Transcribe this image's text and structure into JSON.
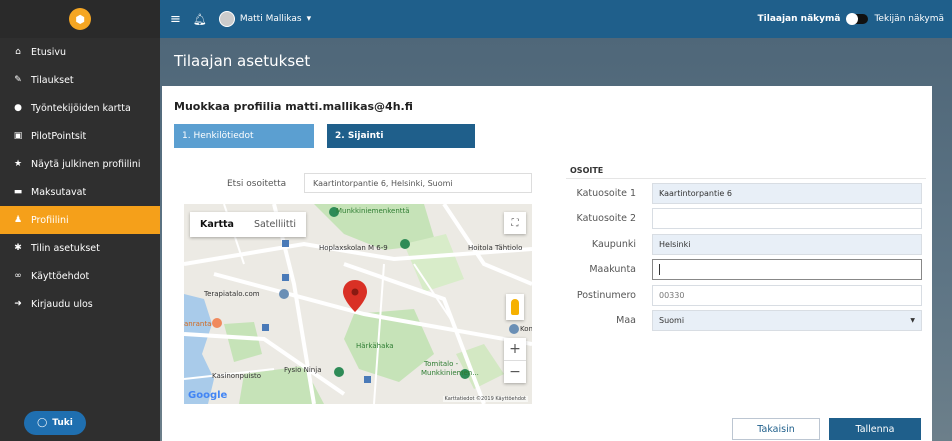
{
  "topbar": {
    "menu_icon": "hamburger-icon",
    "bell_icon": "bell-icon",
    "user_name": "Matti Mallikas",
    "caret": "▾",
    "view_client": "Tilaajan näkymä",
    "view_worker": "Tekijän näkymä"
  },
  "sidebar": {
    "items": [
      {
        "label": "Etusivu",
        "icon": "home-icon",
        "glyph": "⌂"
      },
      {
        "label": "Tilaukset",
        "icon": "edit-icon",
        "glyph": "✎"
      },
      {
        "label": "Työntekijöiden kartta",
        "icon": "location-icon",
        "glyph": "●"
      },
      {
        "label": "PilotPointsit",
        "icon": "briefcase-icon",
        "glyph": "▣"
      },
      {
        "label": "Näytä julkinen profiilini",
        "icon": "star-icon",
        "glyph": "★"
      },
      {
        "label": "Maksutavat",
        "icon": "card-icon",
        "glyph": "▬"
      },
      {
        "label": "Profiilini",
        "icon": "user-icon",
        "glyph": "♟"
      },
      {
        "label": "Tilin asetukset",
        "icon": "gear-icon",
        "glyph": "✱"
      },
      {
        "label": "Käyttöehdot",
        "icon": "handshake-icon",
        "glyph": "∞"
      },
      {
        "label": "Kirjaudu ulos",
        "icon": "logout-icon",
        "glyph": "➜"
      }
    ],
    "active_index": 6,
    "support_label": "Tuki"
  },
  "page": {
    "title": "Tilaajan asetukset",
    "card_title": "Muokkaa profiilia matti.mallikas@4h.fi",
    "tabs": [
      "1. Henkilötiedot",
      "2. Sijainti"
    ],
    "active_tab": 1
  },
  "search": {
    "label": "Etsi osoitetta",
    "value": "Kaartintorpantie 6, Helsinki, Suomi"
  },
  "map": {
    "type_map": "Kartta",
    "type_satellite": "Satelliitti",
    "google": "Google",
    "attribution": "Karttatiedot ©2019   Käyttöehdot",
    "labels": {
      "munkkiniemenkentta": "Munkkiniemenkenttä",
      "hoplaxskolan": "Hoplaxskolan M 6-9",
      "hoitola": "Hoitola Tähtiolo",
      "terapiatalo": "Terapiatalo.com",
      "harkahaka": "Härkähaka",
      "tomitalo": "Tomitalo -",
      "munkkiniemen": "Munkkiniemen...",
      "kasinonpuisto": "Kasinonpuisto",
      "fysio": "Fysio Ninja",
      "ranta": "anranta",
      "kon": "Kon"
    }
  },
  "address": {
    "heading": "OSOITE",
    "fields": [
      {
        "label": "Katuosoite 1",
        "value": "Kaartintorpantie 6",
        "placeholder": ""
      },
      {
        "label": "Katuosoite 2",
        "value": "",
        "placeholder": ""
      },
      {
        "label": "Kaupunki",
        "value": "Helsinki",
        "placeholder": ""
      },
      {
        "label": "Maakunta",
        "value": "",
        "placeholder": ""
      },
      {
        "label": "Postinumero",
        "value": "",
        "placeholder": "00330"
      },
      {
        "label": "Maa",
        "value": "Suomi",
        "placeholder": ""
      }
    ]
  },
  "actions": {
    "back": "Takaisin",
    "save": "Tallenna"
  },
  "colors": {
    "primary": "#1f5f8b",
    "tab_inactive": "#5b9fd1",
    "sidebar": "#2f2f2f",
    "active_orange": "#f5a01a",
    "map_pin": "#d93025"
  }
}
